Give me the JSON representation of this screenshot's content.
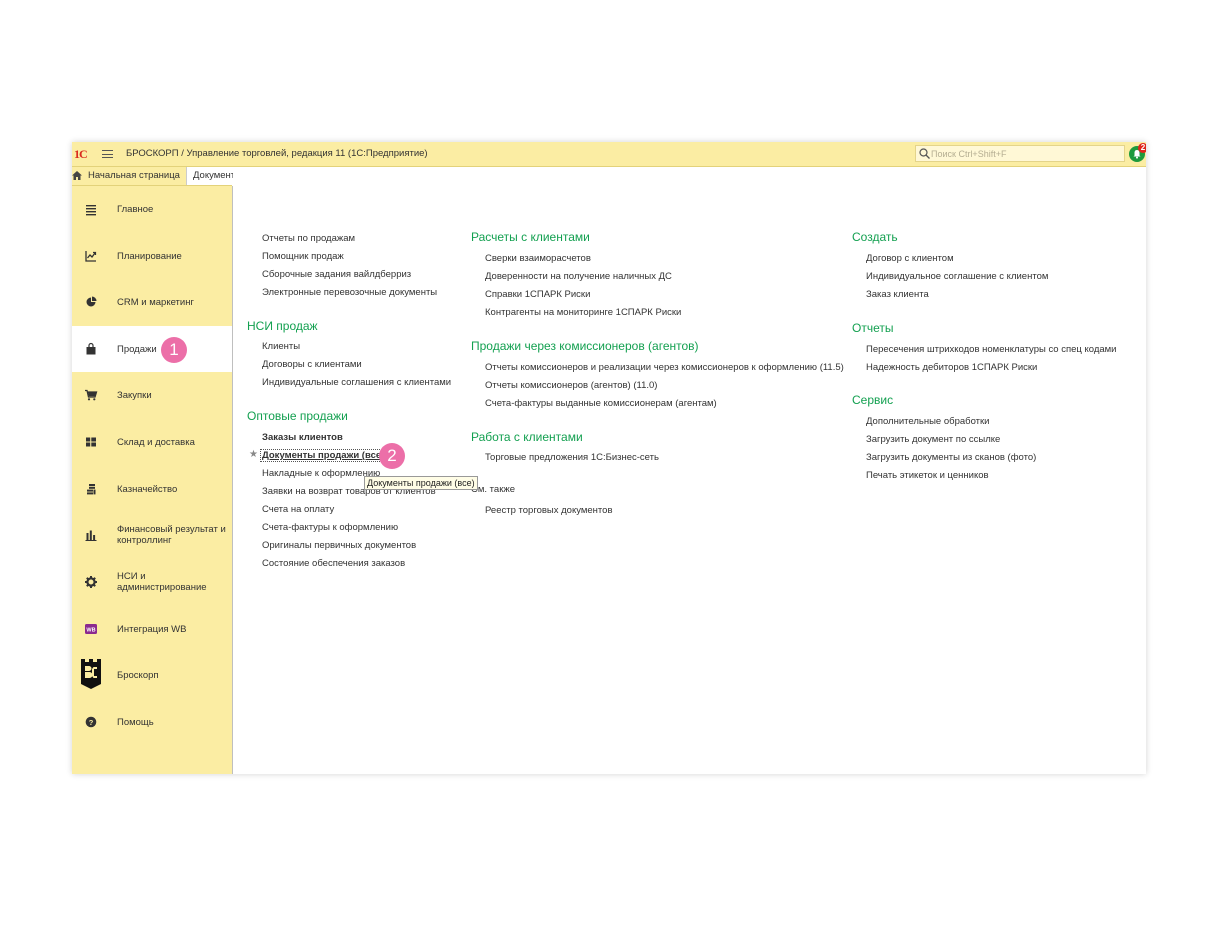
{
  "window": {
    "logo": "1С",
    "title": "БРОСКОРП / Управление торговлей, редакция 11  (1С:Предприятие)",
    "search_placeholder": "Поиск Ctrl+Shift+F",
    "notifications_count": "2"
  },
  "tabs": {
    "home": "Начальная страница",
    "documents": "Документы продажи (все)"
  },
  "sidebar": {
    "items": [
      {
        "label": "Главное",
        "icon": "list-icon"
      },
      {
        "label": "Планирование",
        "icon": "planning-chart-icon"
      },
      {
        "label": "CRM и маркетинг",
        "icon": "pie-chart-icon"
      },
      {
        "label": "Продажи",
        "icon": "shopping-bag-icon"
      },
      {
        "label": "Закупки",
        "icon": "cart-icon"
      },
      {
        "label": "Склад и доставка",
        "icon": "warehouse-grid-icon"
      },
      {
        "label": "Казначейство",
        "icon": "coins-icon"
      },
      {
        "label": "Финансовый результат и контроллинг",
        "icon": "bar-chart-icon"
      },
      {
        "label": "НСИ и администрирование",
        "icon": "gear-icon"
      },
      {
        "label": "Интеграция WB",
        "icon": "wb-logo-icon",
        "icon_text": "WB"
      },
      {
        "label": "Броскорп",
        "icon": "broskorp-logo-icon"
      },
      {
        "label": "Помощь",
        "icon": "help-icon"
      }
    ],
    "active_index": 3
  },
  "markers": [
    "1",
    "2"
  ],
  "col1": {
    "top_links": [
      "Отчеты по продажам",
      "Помощник продаж",
      "Сборочные задания вайлдберриз",
      "Электронные перевозочные документы"
    ],
    "nsi": {
      "header": "НСИ продаж",
      "links": [
        "Клиенты",
        "Договоры с клиентами",
        "Индивидуальные соглашения с клиентами"
      ]
    },
    "wholesale": {
      "header": "Оптовые продажи",
      "links": [
        "Заказы клиентов",
        "Документы продажи (все)",
        "Накладные к оформлению",
        "Заявки на возврат товаров от клиентов",
        "Счета на оплату",
        "Счета-фактуры к оформлению",
        "Оригиналы первичных документов",
        "Состояние обеспечения заказов"
      ]
    }
  },
  "col2": {
    "settlements": {
      "header": "Расчеты с клиентами",
      "links": [
        "Сверки взаиморасчетов",
        "Доверенности на получение наличных ДС",
        "Справки 1СПАРК Риски",
        "Контрагенты на мониторинге 1СПАРК Риски"
      ]
    },
    "agents": {
      "header": "Продажи через комиссионеров (агентов)",
      "links": [
        "Отчеты комиссионеров и реализации через комиссионеров к оформлению (11.5)",
        "Отчеты комиссионеров (агентов) (11.0)",
        "Счета-фактуры выданные комиссионерам (агентам)"
      ]
    },
    "clients": {
      "header": "Работа с клиентами",
      "links": [
        "Торговые предложения 1С:Бизнес-сеть"
      ]
    },
    "see_also": {
      "header": "См. также",
      "links": [
        "Реестр торговых документов"
      ]
    }
  },
  "col3": {
    "create": {
      "header": "Создать",
      "links": [
        "Договор с клиентом",
        "Индивидуальное соглашение с клиентом",
        "Заказ клиента"
      ]
    },
    "reports": {
      "header": "Отчеты",
      "links": [
        "Пересечения штрихкодов номенклатуры со спец кодами",
        "Надежность дебиторов 1СПАРК Риски"
      ]
    },
    "service": {
      "header": "Сервис",
      "links": [
        "Дополнительные обработки",
        "Загрузить документ по ссылке",
        "Загрузить документы из сканов (фото)",
        "Печать этикеток и ценников"
      ]
    }
  },
  "tooltip": "Документы продажи (все)",
  "colors": {
    "header_green": "#13a050",
    "panel_yellow": "#fbeda3",
    "marker_pink": "#ec6fa8"
  }
}
